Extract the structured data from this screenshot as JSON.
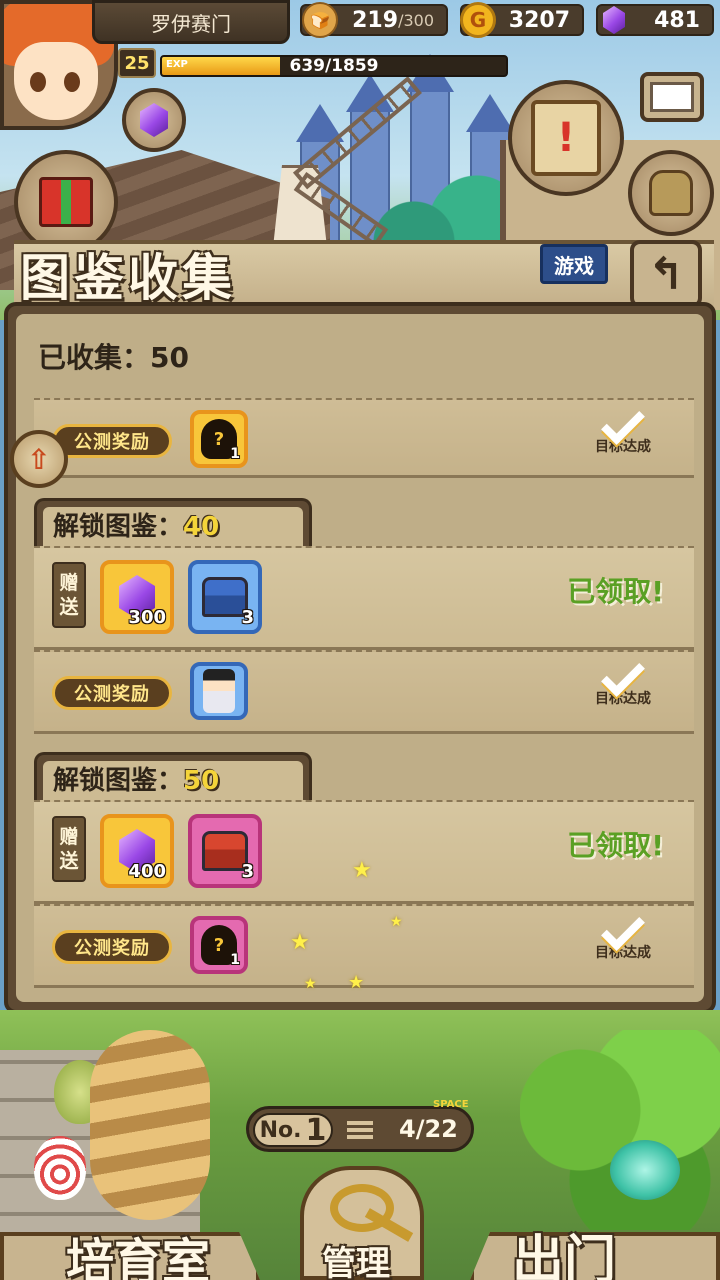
{
  "player": {
    "name": "罗伊赛门",
    "level": "25",
    "exp_text": "639/1859",
    "exp_label": "EXP",
    "exp_fraction": 0.344
  },
  "resources": {
    "bread_value": "219",
    "bread_max": "/300",
    "gold": "3207",
    "gems": "481"
  },
  "header": {
    "title": "图鉴收集",
    "game_tag": "游戏",
    "back_icon": "back-arrow-icon"
  },
  "collection": {
    "collected_text": "已收集：50",
    "partial_row": {
      "beta_label": "公测奖励",
      "reward_count": "1",
      "status": "目标达成"
    },
    "groups": [
      {
        "title_prefix": "解锁图鉴：",
        "title_num": "40",
        "gift_label_1": "赠",
        "gift_label_2": "送",
        "items": [
          {
            "type": "gem",
            "count": "300"
          },
          {
            "type": "blue-chest",
            "count": "3"
          }
        ],
        "claimed_text": "已领取!",
        "beta_label": "公测奖励",
        "beta_reward_count": "",
        "beta_status": "目标达成"
      },
      {
        "title_prefix": "解锁图鉴：",
        "title_num": "50",
        "gift_label_1": "赠",
        "gift_label_2": "送",
        "items": [
          {
            "type": "gem",
            "count": "400"
          },
          {
            "type": "red-chest",
            "count": "3"
          }
        ],
        "claimed_text": "已领取!",
        "beta_label": "公测奖励",
        "beta_reward_count": "1",
        "beta_status": "目标达成"
      }
    ]
  },
  "footer": {
    "no_label": "No.",
    "no_value": "1",
    "space_label": "SPACE",
    "space_value": "4/22",
    "nav_left": "培育室",
    "nav_center": "管理",
    "nav_right": "出门"
  },
  "colors": {
    "claimed_green": "#5aa024",
    "title_number_yellow": "#f4d43a",
    "panel_brown": "#5e4a33"
  }
}
